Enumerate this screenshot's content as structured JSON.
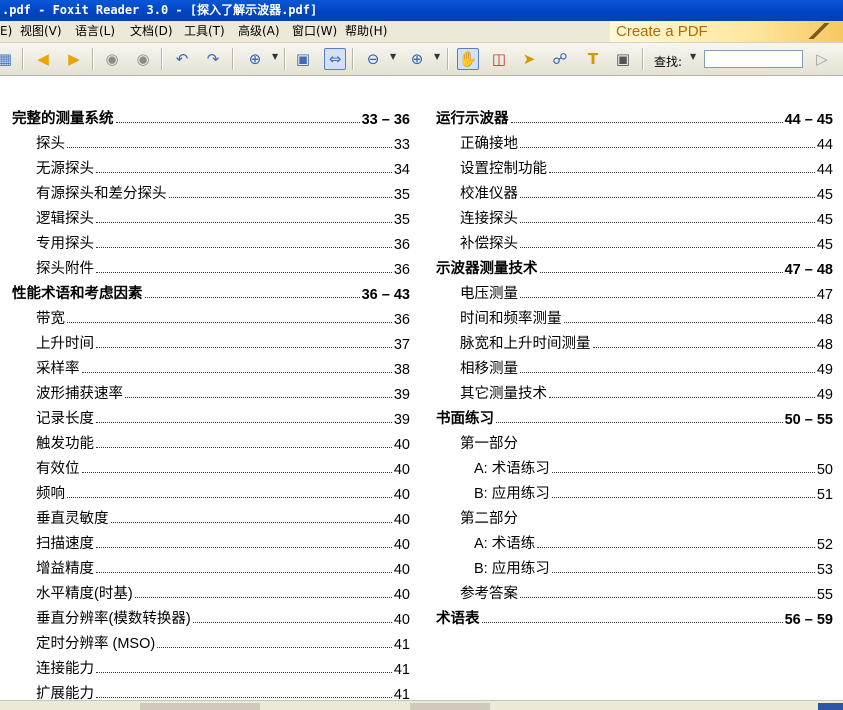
{
  "window": {
    "title": ".pdf - Foxit Reader 3.0 - [探入了解示波器.pdf]"
  },
  "menu": [
    {
      "label": "E)"
    },
    {
      "label": "视图(V)"
    },
    {
      "label": "语言(L)"
    },
    {
      "label": "文档(D)"
    },
    {
      "label": "工具(T)"
    },
    {
      "label": "高级(A)"
    },
    {
      "label": "窗口(W)"
    },
    {
      "label": "帮助(H)"
    }
  ],
  "banner": {
    "text": "Create a PDF"
  },
  "toolbar": {
    "icons": [
      "open-icon",
      "prev-page-icon",
      "next-page-icon",
      "back-icon",
      "forward-icon",
      "rotate-left-icon",
      "rotate-right-icon",
      "zoom-in-icon",
      "fit-page-icon",
      "fit-width-icon",
      "zoom-out-icon",
      "zoom-plus-icon",
      "hand-tool-icon",
      "snapshot-icon",
      "select-icon",
      "find-binoculars-icon",
      "text-select-icon",
      "camera-icon"
    ],
    "find_label": "查找:",
    "find_value": ""
  },
  "toc": {
    "left": [
      {
        "title": "完整的测量系统",
        "page": "33 – 36",
        "level": 0
      },
      {
        "title": "探头",
        "page": "33",
        "level": 1
      },
      {
        "title": "无源探头",
        "page": "34",
        "level": 1
      },
      {
        "title": "有源探头和差分探头",
        "page": "35",
        "level": 1
      },
      {
        "title": "逻辑探头",
        "page": "35",
        "level": 1
      },
      {
        "title": "专用探头",
        "page": "36",
        "level": 1
      },
      {
        "title": "探头附件",
        "page": "36",
        "level": 1
      },
      {
        "title": "性能术语和考虑因素",
        "page": "36 – 43",
        "level": 0
      },
      {
        "title": "带宽",
        "page": "36",
        "level": 1
      },
      {
        "title": "上升时间",
        "page": "37",
        "level": 1
      },
      {
        "title": "采样率",
        "page": "38",
        "level": 1
      },
      {
        "title": "波形捕获速率",
        "page": "39",
        "level": 1
      },
      {
        "title": "记录长度",
        "page": "39",
        "level": 1
      },
      {
        "title": "触发功能",
        "page": "40",
        "level": 1
      },
      {
        "title": "有效位",
        "page": "40",
        "level": 1
      },
      {
        "title": "频响",
        "page": "40",
        "level": 1
      },
      {
        "title": "垂直灵敏度",
        "page": "40",
        "level": 1
      },
      {
        "title": "扫描速度",
        "page": "40",
        "level": 1
      },
      {
        "title": "增益精度",
        "page": "40",
        "level": 1
      },
      {
        "title": "水平精度(时基)",
        "page": "40",
        "level": 1
      },
      {
        "title": "垂直分辨率(模数转换器)",
        "page": "40",
        "level": 1
      },
      {
        "title": "定时分辨率 (MSO)",
        "page": "41",
        "level": 1
      },
      {
        "title": "连接能力",
        "page": "41",
        "level": 1
      },
      {
        "title": "扩展能力",
        "page": "41",
        "level": 1
      }
    ],
    "right": [
      {
        "title": "运行示波器",
        "page": "44 – 45",
        "level": 0
      },
      {
        "title": "正确接地",
        "page": "44",
        "level": 1
      },
      {
        "title": "设置控制功能",
        "page": "44",
        "level": 1
      },
      {
        "title": "校准仪器",
        "page": "45",
        "level": 1
      },
      {
        "title": "连接探头",
        "page": "45",
        "level": 1
      },
      {
        "title": "补偿探头",
        "page": "45",
        "level": 1
      },
      {
        "title": "示波器测量技术",
        "page": "47 – 48",
        "level": 0
      },
      {
        "title": "电压测量",
        "page": "47",
        "level": 1
      },
      {
        "title": "时间和频率测量",
        "page": "48",
        "level": 1
      },
      {
        "title": "脉宽和上升时间测量",
        "page": "48",
        "level": 1
      },
      {
        "title": "相移测量",
        "page": "49",
        "level": 1
      },
      {
        "title": "其它测量技术",
        "page": "49",
        "level": 1
      },
      {
        "title": "书面练习",
        "page": "50 – 55",
        "level": 0
      },
      {
        "title": "第一部分",
        "page": "",
        "level": 1
      },
      {
        "title": "A: 术语练习",
        "page": "50",
        "level": 2
      },
      {
        "title": "B: 应用练习",
        "page": "51",
        "level": 2
      },
      {
        "title": "第二部分",
        "page": "",
        "level": 1
      },
      {
        "title": "A: 术语练",
        "page": "52",
        "level": 2
      },
      {
        "title": "B: 应用练习",
        "page": "53",
        "level": 2
      },
      {
        "title": "参考答案",
        "page": "55",
        "level": 1
      },
      {
        "title": "术语表",
        "page": "56 – 59",
        "level": 0
      }
    ]
  }
}
